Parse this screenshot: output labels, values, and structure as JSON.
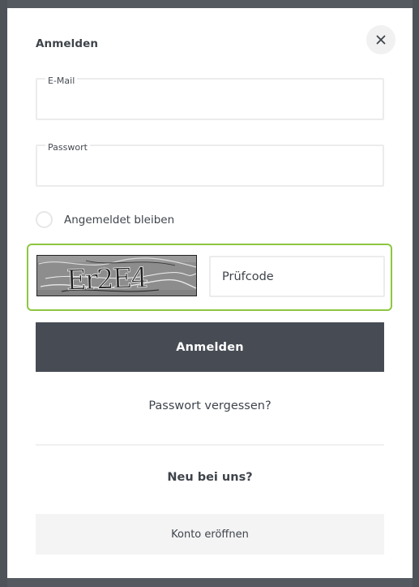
{
  "modal": {
    "title": "Anmelden",
    "close_icon": "close-icon"
  },
  "form": {
    "email": {
      "label": "E-Mail",
      "value": ""
    },
    "password": {
      "label": "Passwort",
      "value": ""
    },
    "remember": {
      "label": "Angemeldet bleiben",
      "checked": false
    },
    "captcha": {
      "image_text": "Er2E4",
      "placeholder": "Prüfcode",
      "accent": "#8ec641"
    },
    "submit_label": "Anmelden"
  },
  "links": {
    "forgot_password": "Passwort vergessen?"
  },
  "register": {
    "heading": "Neu bei uns?",
    "button_label": "Konto eröffnen"
  },
  "colors": {
    "primary_button": "#474c54",
    "captcha_border": "#8ec641"
  }
}
